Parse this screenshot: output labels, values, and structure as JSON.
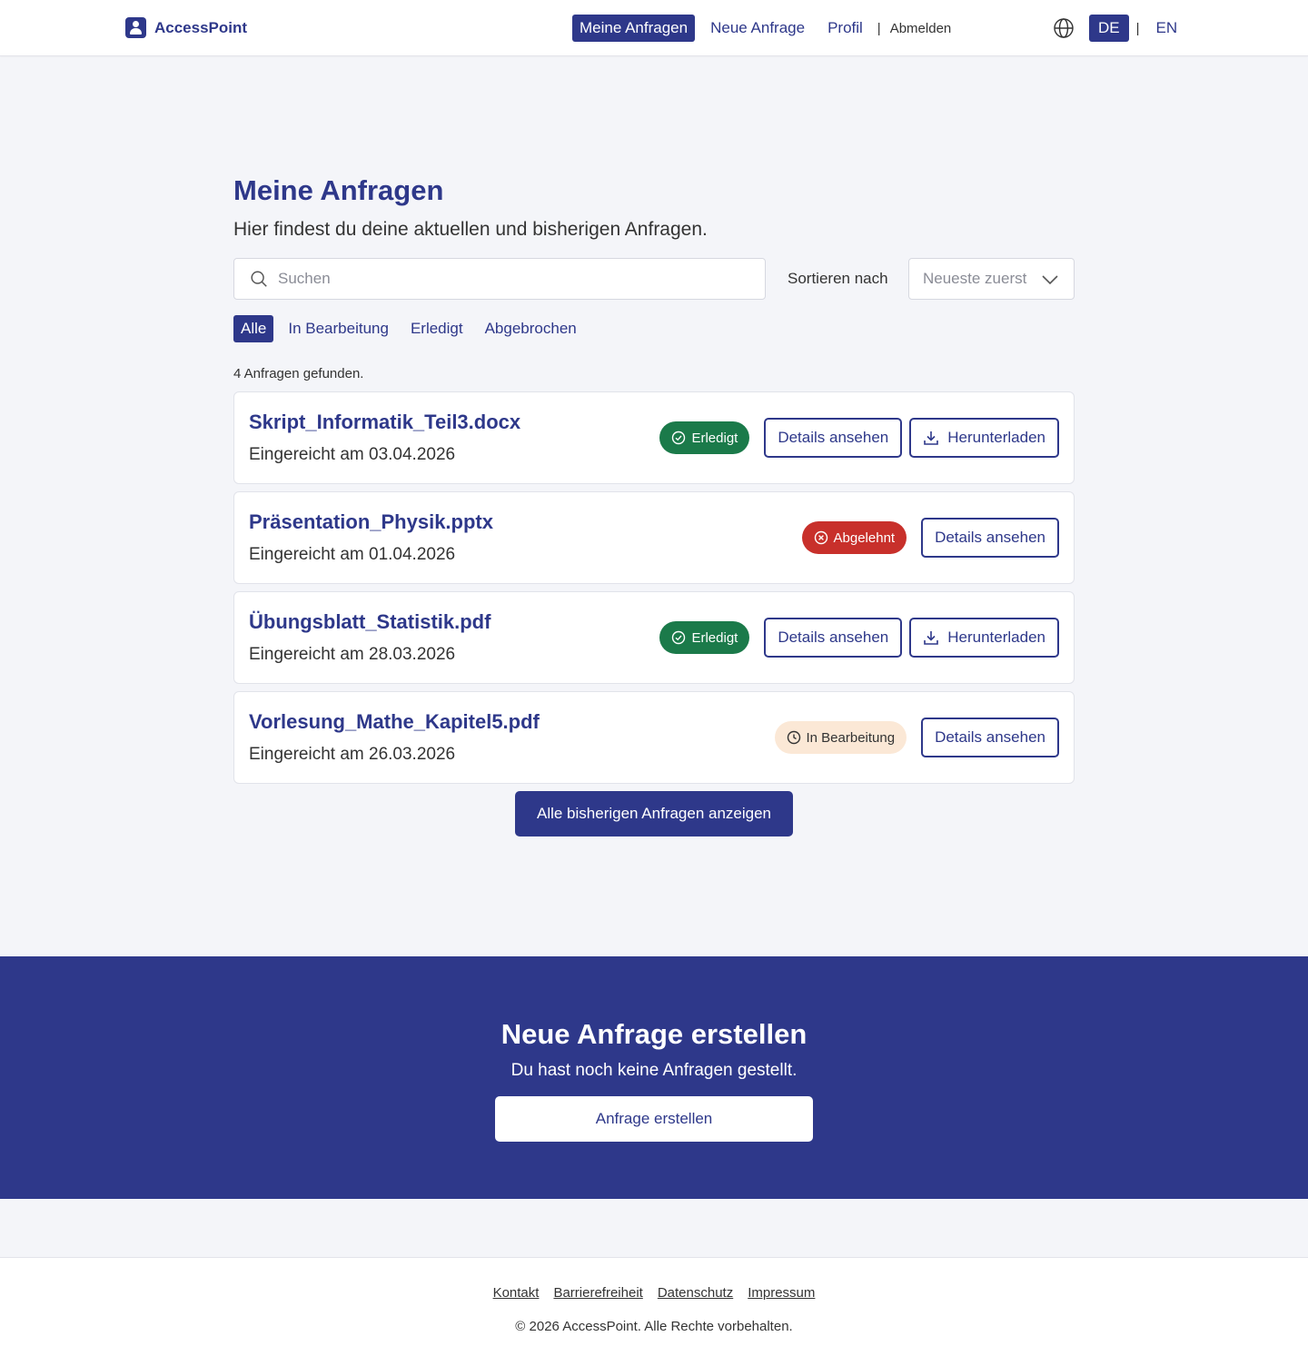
{
  "header": {
    "brand": "AccessPoint",
    "nav": [
      "Meine Anfragen",
      "Neue Anfrage",
      "Profil"
    ],
    "separator": "|",
    "logout": "Abmelden",
    "languages": [
      "DE",
      "EN"
    ],
    "active_language": "DE"
  },
  "main": {
    "title": "Meine Anfragen",
    "subtitle": "Hier findest du deine aktuellen und bisherigen Anfragen.",
    "search_placeholder": "Suchen",
    "sort_label": "Sortieren nach",
    "sort_value": "Neueste zuerst",
    "filters": [
      "Alle",
      "In Bearbeitung",
      "Erledigt",
      "Abgebrochen"
    ],
    "active_filter": "Alle",
    "result_count": "4 Anfragen gefunden.",
    "requests": [
      {
        "title": "Skript_Informatik_Teil3.docx",
        "date": "Eingereicht am 03.04.2026",
        "status": "Erledigt",
        "details": "Details ansehen",
        "download": "Herunterladen"
      },
      {
        "title": "Präsentation_Physik.pptx",
        "date": "Eingereicht am 01.04.2026",
        "status": "Abgelehnt",
        "details": "Details ansehen"
      },
      {
        "title": "Übungsblatt_Statistik.pdf",
        "date": "Eingereicht am 28.03.2026",
        "status": "Erledigt",
        "details": "Details ansehen",
        "download": "Herunterladen"
      },
      {
        "title": "Vorlesung_Mathe_Kapitel5.pdf",
        "date": "Eingereicht am 26.03.2026",
        "status": "In Bearbeitung",
        "details": "Details ansehen"
      }
    ],
    "show_all_label": "Alle bisherigen Anfragen anzeigen"
  },
  "cta": {
    "title": "Neue Anfrage erstellen",
    "subtitle": "Du hast noch keine Anfragen gestellt.",
    "button": "Anfrage erstellen"
  },
  "footer": {
    "links": [
      "Kontakt",
      "Barrierefreiheit",
      "Datenschutz",
      "Impressum"
    ],
    "copyright": "© 2026 AccessPoint. Alle Rechte vorbehalten."
  },
  "colors": {
    "brand": "#2e388a",
    "status_done": "#1b7a4a",
    "status_rejected": "#c8302b",
    "status_progress": "#fbe8d6",
    "background": "#f4f5f9"
  },
  "icons": [
    "user-icon",
    "globe-icon",
    "search-icon",
    "chevron-down-icon",
    "check-circle-icon",
    "x-circle-icon",
    "clock-icon",
    "download-icon"
  ]
}
